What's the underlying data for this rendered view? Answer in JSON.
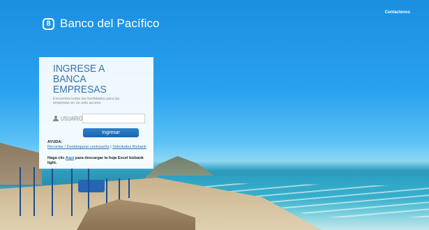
{
  "header": {
    "brand_mark": "8",
    "brand_name": "Banco del Pacífico",
    "contact_link": "Contactenos"
  },
  "login": {
    "title_line1": "INGRESE A",
    "title_line2": "BANCA EMPRESAS",
    "subtitle": "Encuentra todas las facilidades para las empresas en un solo acceso",
    "user_label": "USUARIO",
    "user_value": "",
    "user_placeholder": "",
    "submit_label": "Ingresar",
    "help_title": "AYUDA:",
    "help_link_1": "Recordar / Desbloquear contraseña",
    "help_sep": "|",
    "help_link_2": "Solicitudes Bizbank",
    "excel_pre": "Haga clic ",
    "excel_link": "Aquí",
    "excel_post": " para descargar la hoja Excel bizbank light."
  },
  "colors": {
    "accent": "#1a66b0",
    "title": "#3a73a8",
    "link": "#2a6db5"
  },
  "icons": {
    "brand": "banco-pacifico-logo-icon",
    "user": "user-icon"
  }
}
